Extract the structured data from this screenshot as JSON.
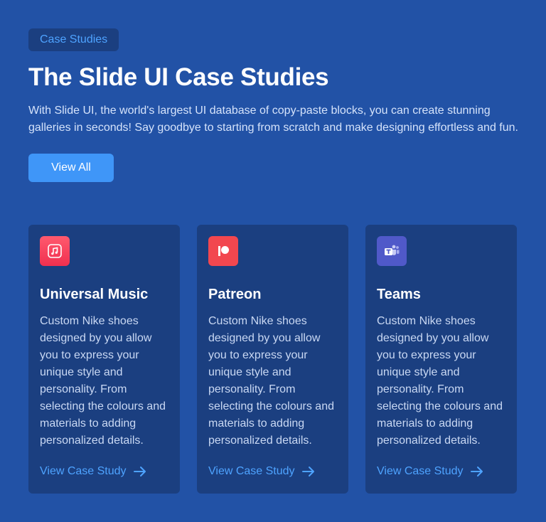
{
  "header": {
    "badge": "Case Studies",
    "title": "The Slide UI Case Studies",
    "description": "With Slide UI, the world's largest UI database of copy-paste blocks, you can create stunning galleries in seconds! Say goodbye to starting from scratch and make designing effortless and fun.",
    "view_all_label": "View All"
  },
  "cards": [
    {
      "title": "Universal Music",
      "icon": "music-note-icon",
      "icon_color": "#f43d5c",
      "text": "Custom Nike shoes designed by you allow you to express your unique style and personality. From selecting the colours and materials to adding personalized details.",
      "link_label": "View Case Study"
    },
    {
      "title": "Patreon",
      "icon": "patreon-icon",
      "icon_color": "#f2474f",
      "text": "Custom Nike shoes designed by you allow you to express your unique style and personality. From selecting the colours and materials to adding personalized details.",
      "link_label": "View Case Study"
    },
    {
      "title": "Teams",
      "icon": "teams-icon",
      "icon_color": "#5059c9",
      "text": "Custom Nike shoes designed by you allow you to express your unique style and personality. From selecting the colours and materials to adding personalized details.",
      "link_label": "View Case Study"
    }
  ],
  "colors": {
    "background": "#2252a6",
    "card": "#1b3f80",
    "accent": "#4ea3ff",
    "button": "#3f96f8"
  }
}
